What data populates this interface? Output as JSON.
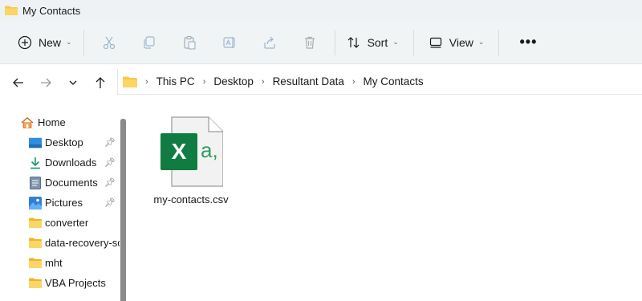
{
  "window": {
    "title": "My Contacts"
  },
  "toolbar": {
    "new_label": "New",
    "sort_label": "Sort",
    "view_label": "View",
    "more_label": "•••"
  },
  "breadcrumb": [
    "This PC",
    "Desktop",
    "Resultant Data",
    "My Contacts"
  ],
  "sidebar": {
    "items": [
      {
        "label": "Home",
        "icon": "home-icon",
        "pinned": false
      },
      {
        "label": "Desktop",
        "icon": "desktop-icon",
        "pinned": true
      },
      {
        "label": "Downloads",
        "icon": "downloads-icon",
        "pinned": true
      },
      {
        "label": "Documents",
        "icon": "documents-icon",
        "pinned": true
      },
      {
        "label": "Pictures",
        "icon": "pictures-icon",
        "pinned": true
      },
      {
        "label": "converter",
        "icon": "folder-icon",
        "pinned": false
      },
      {
        "label": "data-recovery-so",
        "icon": "folder-icon",
        "pinned": false
      },
      {
        "label": "mht",
        "icon": "folder-icon",
        "pinned": false
      },
      {
        "label": "VBA Projects",
        "icon": "folder-icon",
        "pinned": false
      }
    ]
  },
  "files": [
    {
      "name": "my-contacts.csv",
      "icon": "excel-csv-icon",
      "badge_letter": "X",
      "preview_text": "a,"
    }
  ],
  "colors": {
    "folder_yellow": "#f7c948",
    "excel_green": "#107c41",
    "accent_blue": "#0067c0"
  }
}
